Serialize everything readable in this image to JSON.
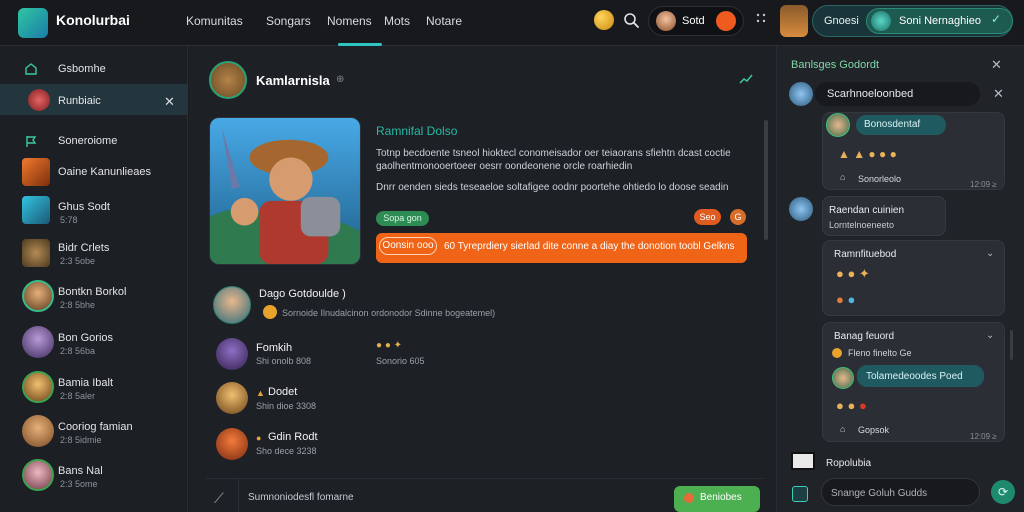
{
  "header": {
    "app_name": "Konolurbai",
    "nav": [
      "Komunitas",
      "Songars",
      "Nomens",
      "Mots",
      "Notare"
    ],
    "user_name": "Sotd",
    "right_label": "Gnoesi",
    "right_button": "Soni Nernaghieo"
  },
  "sidebar": {
    "items": [
      {
        "label": "Gsbomhe"
      },
      {
        "label": "Runbiaic"
      },
      {
        "label": "Soneroiome"
      },
      {
        "label": "Oaine Kanunlieaes"
      },
      {
        "label": "Ghus Sodt",
        "sub": "5:78"
      },
      {
        "label": "Bidr Crlets",
        "sub": "2:3 5obe"
      },
      {
        "label": "Bontkn Borkol",
        "sub": "2:8 5bhe"
      },
      {
        "label": "Bon Gorios",
        "sub": "2:8 56ba"
      },
      {
        "label": "Bamia Ibalt",
        "sub": "2:8 5aler"
      },
      {
        "label": "Cooriog famian",
        "sub": "2:8 5idmie"
      },
      {
        "label": "Bans Nal",
        "sub": "2:3 5ome"
      }
    ]
  },
  "main": {
    "header_title": "Kamlarnisla",
    "header_extra": "⊕",
    "card_title": "Ramnifal Dolso",
    "card_body": "Totnp becdoente tsneol hioktecl conomeisador oer teiaorans sfiehtn dcast coctie gaolhentmonooertoeer oesrr oondeonene orcle roarhiedin",
    "card_body2": "Dnrr oenden sieds teseaeloe soltafigee oodnr poortehe ohtiedo lo doose seadin",
    "pill_green": "Sopa gon",
    "pill_orange": "Seo",
    "pill_orange2": "G",
    "banner_pill": "Oonsin ooo",
    "banner_text": "60 Tyreprdiery sierlad dite conne a diay the donotion toobl Gelkns",
    "comment1_name": "Dago Gotdoulde )",
    "comment1_sub": "Sornoide Ilnudalcinon ordonodor Sdinne bogeatemel)",
    "comment2_name": "Fomkih",
    "comment2_sub": "Shi onolb 808",
    "comment2_react": "Sonorio 605",
    "comment3_name": "Dodet",
    "comment3_sub": "Shin dioe 3308",
    "comment4_name": "Gdin Rodt",
    "comment4_sub": "Sho dece 3238",
    "composer_placeholder": "Sumnoniodesfl fomarne",
    "send_label": "Beniobes"
  },
  "right_panel": {
    "title": "Banlsges Godordt",
    "row1": "Scarhnoeloonbed",
    "box1_chip": "Bonosdentaf",
    "box1_footer": "Sonorleolo",
    "box1_time": "12:09 ≥",
    "box2_title": "Raendan cuinien",
    "box2_sub": "Lorntelnoeneeto",
    "box3_title": "Ramnfituebod",
    "box4_title": "Banag feuord",
    "box4_sub": "Fleno finelto Ge",
    "box4_chip": "Tolamedeoodes Poed",
    "box4_footer": "Gopsok",
    "box4_time": "12:09 ≥",
    "footer": "Ropolubia",
    "input_placeholder": "Snange Goluh Gudds"
  },
  "colors": {
    "accent_teal": "#2ec5c2",
    "accent_green": "#4caf50",
    "accent_orange": "#ef6417"
  }
}
